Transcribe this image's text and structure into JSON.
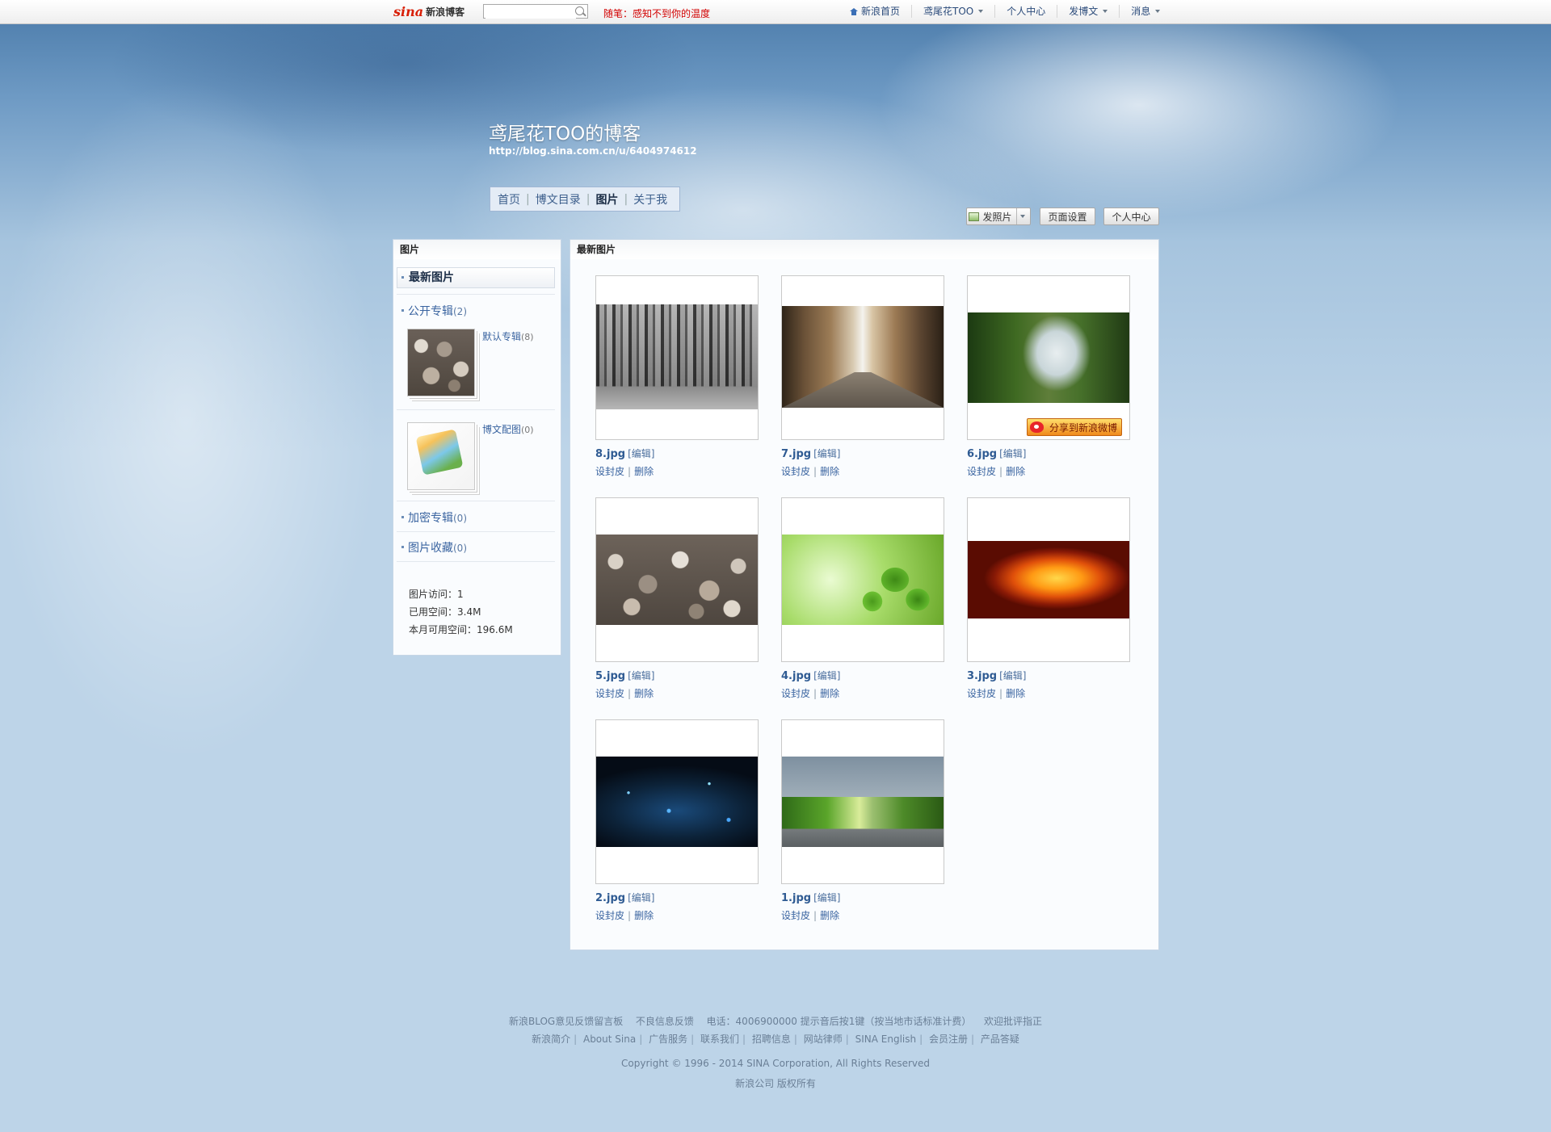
{
  "topbar": {
    "logo_sina": "sina",
    "logo_blog": "新浪博客",
    "search_placeholder": "",
    "essay": "随笔：感知不到你的温度",
    "nav": [
      {
        "label": "新浪首页",
        "icon": "home-icon"
      },
      {
        "label": "鸢尾花TOO",
        "dropdown": true
      },
      {
        "label": "个人中心"
      },
      {
        "label": "发博文",
        "dropdown": true
      },
      {
        "label": "消息",
        "dropdown": true
      }
    ]
  },
  "blog": {
    "title": "鸢尾花TOO的博客",
    "url": "http://blog.sina.com.cn/u/6404974612",
    "nav": [
      "首页",
      "博文目录",
      "图片",
      "关于我"
    ],
    "nav_current": "图片"
  },
  "toolbar": {
    "post_photo": "发照片",
    "page_settings": "页面设置",
    "personal_center": "个人中心"
  },
  "sidebar": {
    "title": "图片",
    "current": "最新图片",
    "public_albums": {
      "label": "公开专辑",
      "count": "(2)"
    },
    "albums": [
      {
        "label": "默认专辑",
        "count": "(8)"
      },
      {
        "label": "博文配图",
        "count": "(0)"
      }
    ],
    "private_albums": {
      "label": "加密专辑",
      "count": "(0)"
    },
    "favorites": {
      "label": "图片收藏",
      "count": "(0)"
    },
    "stats": [
      {
        "label": "图片访问：",
        "value": "1"
      },
      {
        "label": "已用空间：",
        "value": "3.4M"
      },
      {
        "label": "本月可用空间：",
        "value": "196.6M"
      }
    ]
  },
  "main": {
    "title": "最新图片",
    "edit_label": "[编辑]",
    "set_cover": "设封皮",
    "delete": "删除",
    "share_weibo": "分享到新浪微博",
    "photos": [
      {
        "file": "8.jpg"
      },
      {
        "file": "7.jpg"
      },
      {
        "file": "6.jpg"
      },
      {
        "file": "5.jpg"
      },
      {
        "file": "4.jpg"
      },
      {
        "file": "3.jpg"
      },
      {
        "file": "2.jpg"
      },
      {
        "file": "1.jpg"
      }
    ]
  },
  "footer": {
    "line1": [
      "新浪BLOG意见反馈留言板",
      "不良信息反馈",
      "电话：4006900000 提示音后按1键（按当地市话标准计费）",
      "欢迎批评指正"
    ],
    "line2": [
      "新浪简介",
      "About Sina",
      "广告服务",
      "联系我们",
      "招聘信息",
      "网站律师",
      "SINA English",
      "会员注册",
      "产品答疑"
    ],
    "copyright": "Copyright © 1996 - 2014 SINA Corporation, All Rights Reserved",
    "company": "新浪公司 版权所有"
  }
}
